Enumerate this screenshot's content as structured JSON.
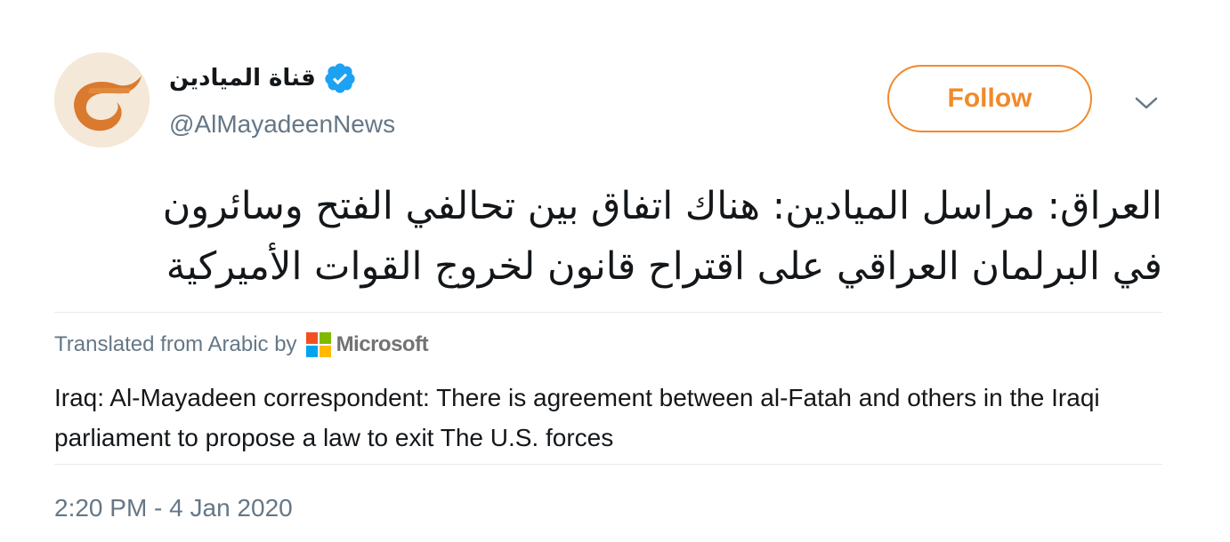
{
  "author": {
    "display_name": "قناة الميادين",
    "handle": "@AlMayadeenNews",
    "verified_icon": "verified-badge-icon",
    "avatar_icon": "al-mayadeen-logo"
  },
  "actions": {
    "follow_label": "Follow",
    "more_icon": "chevron-down-icon"
  },
  "tweet": {
    "text_line_1": "العراق: مراسل الميادين: هناك اتفاق بين تحالفي الفتح وسائرون",
    "text_line_2": "في البرلمان العراقي على اقتراح قانون لخروج القوات الأميركية",
    "translated_from": "Translated from Arabic by",
    "translator_name": "Microsoft",
    "translation": "Iraq: Al-Mayadeen correspondent: There is agreement between al-Fatah and others in the Iraqi parliament to propose a law to exit The U.S. forces",
    "timestamp": "2:20 PM - 4 Jan 2020"
  },
  "colors": {
    "accent": "#f18a2b",
    "verified": "#1da1f2",
    "secondary_text": "#657786",
    "primary_text": "#14171a",
    "divider": "#e6ecf0"
  }
}
